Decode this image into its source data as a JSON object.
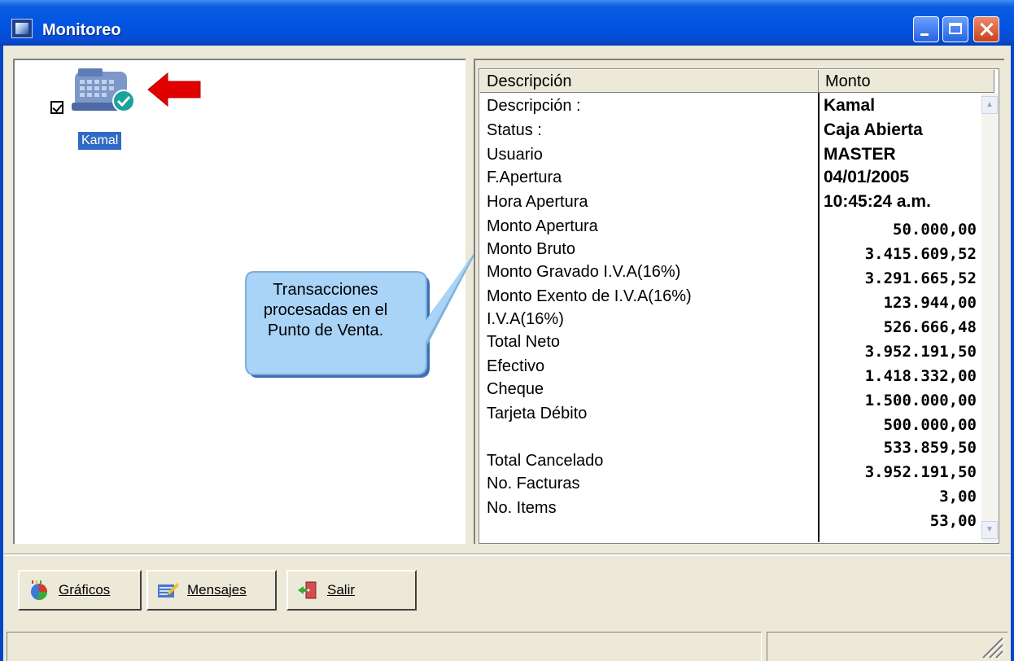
{
  "window": {
    "title": "Monitoreo"
  },
  "colors": {
    "titlebar": "#0054e3",
    "selection": "#316ac5",
    "callout": "#a9d3f7",
    "arrow": "#e00000",
    "face": "#ece9d8"
  },
  "terminals": [
    {
      "label": "Kamal",
      "checked": true,
      "icon": "cash-register-icon",
      "status_icon": "check-badge-icon"
    }
  ],
  "callout": {
    "text": "Transacciones procesadas en el Punto de Venta."
  },
  "list": {
    "columns": [
      "Descripción",
      "Monto"
    ],
    "rows": [
      {
        "desc": "Descripción :",
        "value": "Kamal"
      },
      {
        "desc": "Status     :",
        "value": "Caja Abierta"
      },
      {
        "desc": "Usuario",
        "value": "MASTER"
      },
      {
        "desc": "F.Apertura",
        "value": "04/01/2005"
      },
      {
        "desc": "Hora Apertura",
        "value": "10:45:24 a.m."
      },
      {
        "desc": "Monto Apertura",
        "value": "50.000,00"
      },
      {
        "desc": "Monto Bruto",
        "value": "3.415.609,52"
      },
      {
        "desc": "Monto Gravado I.V.A(16%)",
        "value": "3.291.665,52"
      },
      {
        "desc": "Monto Exento de I.V.A(16%)",
        "value": "123.944,00"
      },
      {
        "desc": "I.V.A(16%)",
        "value": "526.666,48"
      },
      {
        "desc": "Total Neto",
        "value": "3.952.191,50"
      },
      {
        "desc": "Efectivo",
        "value": "1.418.332,00"
      },
      {
        "desc": "Cheque",
        "value": "1.500.000,00"
      },
      {
        "desc": "Tarjeta Débito",
        "value": "500.000,00"
      },
      {
        "desc": "",
        "value": "533.859,50"
      },
      {
        "desc": "Total Cancelado",
        "value": "3.952.191,50"
      },
      {
        "desc": "No. Facturas",
        "value": "3,00"
      },
      {
        "desc": "No. Items",
        "value": "53,00"
      }
    ]
  },
  "buttons": {
    "graficos": {
      "label": "Gráficos",
      "icon": "chart-icon"
    },
    "mensajes": {
      "label": "Mensajes",
      "icon": "message-icon"
    },
    "salir": {
      "label": "Salir",
      "icon": "exit-icon"
    }
  }
}
